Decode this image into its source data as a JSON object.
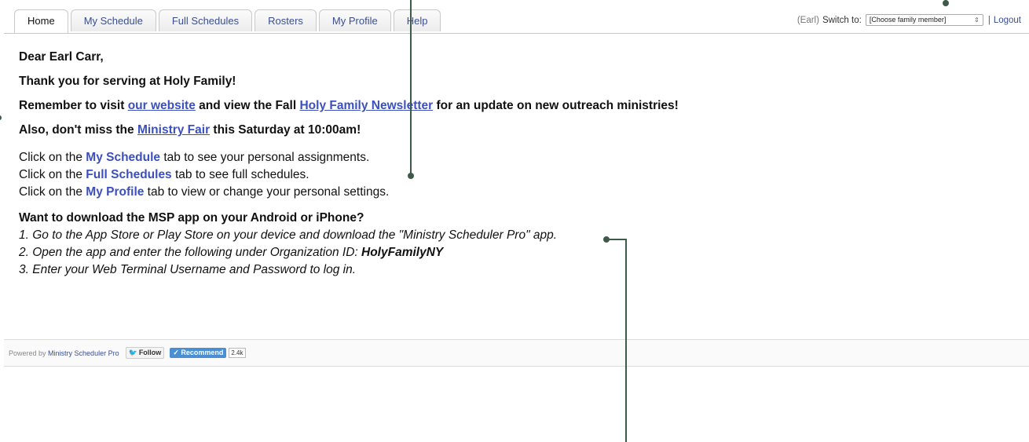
{
  "tabs": [
    {
      "label": "Home",
      "active": true
    },
    {
      "label": "My Schedule",
      "active": false
    },
    {
      "label": "Full Schedules",
      "active": false
    },
    {
      "label": "Rosters",
      "active": false
    },
    {
      "label": "My Profile",
      "active": false
    },
    {
      "label": "Help",
      "active": false
    }
  ],
  "header": {
    "user_tag": "(Earl)",
    "switch_label": "Switch to:",
    "family_select": {
      "selected": "[Choose family member]"
    },
    "separator": "|",
    "logout": "Logout"
  },
  "content": {
    "greeting": "Dear Earl Carr,",
    "thanks": "Thank you for serving at Holy Family!",
    "remember": {
      "pre": "Remember to visit ",
      "link1": "our website",
      "mid": " and view the Fall ",
      "link2": "Holy Family Newsletter",
      "post": " for an update on new outreach ministries!"
    },
    "fair": {
      "pre": "Also, don't miss the ",
      "link": "Ministry Fair",
      "post": " this Saturday at 10:00am!"
    },
    "instructions": [
      {
        "pre": "Click on the ",
        "tab": "My Schedule",
        "post": " tab to see your personal assignments."
      },
      {
        "pre": "Click on the ",
        "tab": "Full Schedules",
        "post": " tab to see full schedules."
      },
      {
        "pre": "Click on the ",
        "tab": "My Profile",
        "post": " tab to view or change your personal settings."
      }
    ],
    "app_heading": "Want to download the MSP app on your Android or iPhone?",
    "app_steps": {
      "s1": "1. Go to the App Store or Play Store on your device and download the \"Ministry Scheduler Pro\" app.",
      "s2_pre": "2. Open the app and enter the following under Organization ID: ",
      "s2_id": "HolyFamilyNY",
      "s3": "3. Enter your Web Terminal Username and Password to log in."
    }
  },
  "footer": {
    "powered_by": "Powered by",
    "msp_link": "Ministry Scheduler Pro",
    "follow": "Follow",
    "recommend": "Recommend",
    "count": "2.4k"
  },
  "colors": {
    "link": "#3b4fbf",
    "callout": "#3e5a48",
    "recommend": "#4a8fd4"
  }
}
